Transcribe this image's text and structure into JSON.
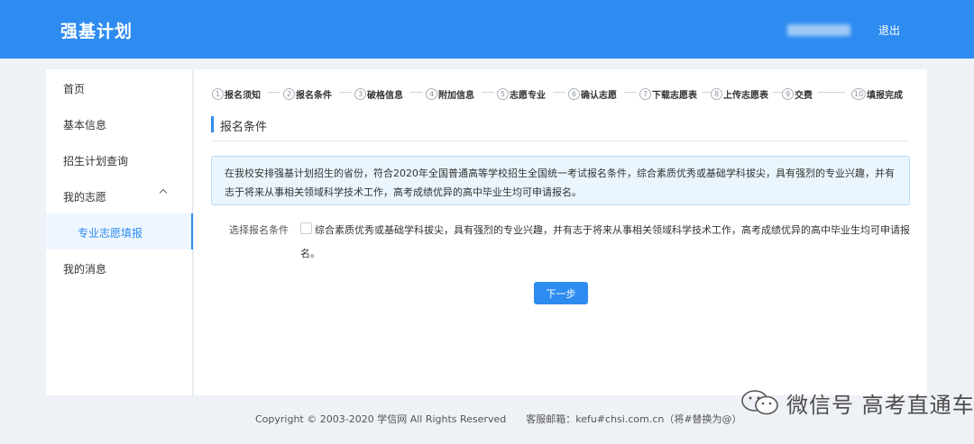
{
  "header": {
    "title": "强基计划",
    "logout_label": "退出"
  },
  "sidebar": {
    "items": [
      {
        "label": "首页"
      },
      {
        "label": "基本信息"
      },
      {
        "label": "招生计划查询"
      },
      {
        "label": "我的志愿"
      },
      {
        "label": "专业志愿填报"
      },
      {
        "label": "我的消息"
      }
    ]
  },
  "steps": [
    {
      "num": "1",
      "label": "报名须知"
    },
    {
      "num": "2",
      "label": "报名条件"
    },
    {
      "num": "3",
      "label": "破格信息"
    },
    {
      "num": "4",
      "label": "附加信息"
    },
    {
      "num": "5",
      "label": "志愿专业"
    },
    {
      "num": "6",
      "label": "确认志愿"
    },
    {
      "num": "7",
      "label": "下载志愿表"
    },
    {
      "num": "8",
      "label": "上传志愿表"
    },
    {
      "num": "9",
      "label": "交费"
    },
    {
      "num": "10",
      "label": "填报完成"
    }
  ],
  "section": {
    "title": "报名条件"
  },
  "notice": {
    "text": "在我校安排强基计划招生的省份，符合2020年全国普通高等学校招生全国统一考试报名条件，综合素质优秀或基础学科拔尖，具有强烈的专业兴趣，并有志于将来从事相关领域科学技术工作，高考成绩优异的高中毕业生均可申请报名。"
  },
  "condition": {
    "label": "选择报名条件",
    "text": "综合素质优秀或基础学科拔尖，具有强烈的专业兴趣，并有志于将来从事相关领域科学技术工作，高考成绩优异的高中毕业生均可申请报名。",
    "checked": false
  },
  "actions": {
    "next_label": "下一步"
  },
  "footer": {
    "copyright": "Copyright © 2003-2020 学信网 All Rights Reserved",
    "email": "客服邮箱：kefu#chsi.com.cn（将#替换为@）"
  },
  "watermark": {
    "text": "微信号 高考直通车"
  },
  "colors": {
    "primary": "#2e8cf0",
    "background": "#eef1f6"
  }
}
